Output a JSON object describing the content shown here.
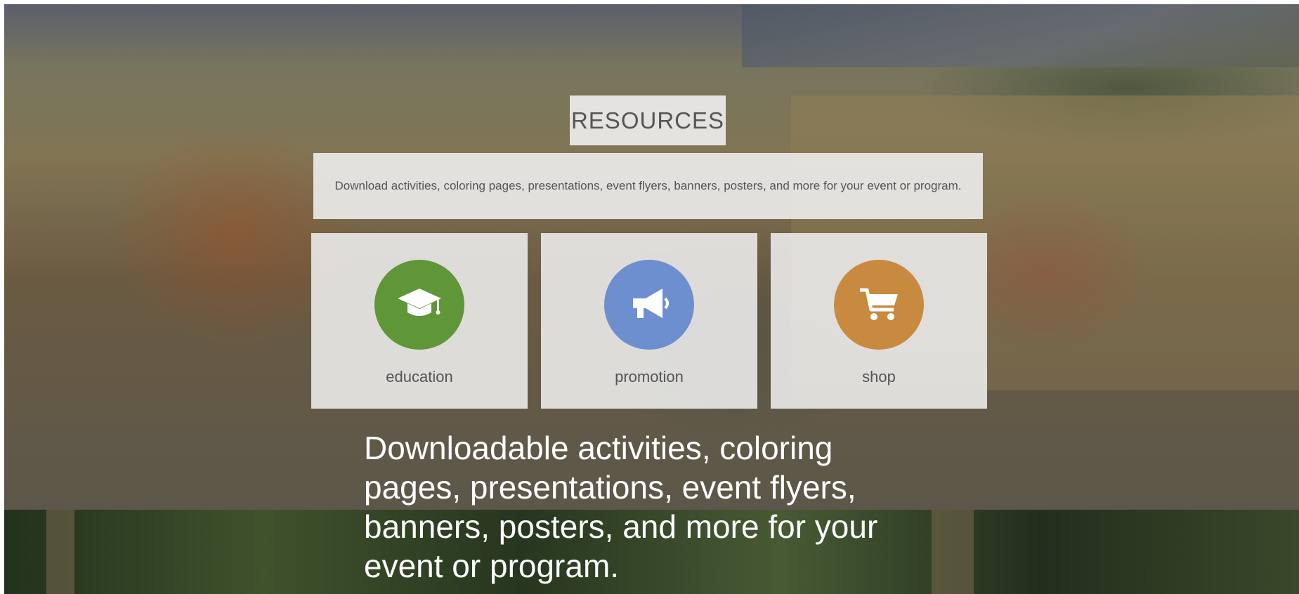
{
  "hero": {
    "title": "RESOURCES",
    "description": "Download activities, coloring pages, presentations, event flyers, banners, posters, and more for your event or program."
  },
  "cards": [
    {
      "label": "education",
      "color": "#5f9638",
      "icon": "graduation-cap-icon"
    },
    {
      "label": "promotion",
      "color": "#6e8fcf",
      "icon": "megaphone-icon"
    },
    {
      "label": "shop",
      "color": "#c88a3f",
      "icon": "shopping-cart-icon"
    }
  ],
  "caption": "Downloadable activities, coloring pages, presentations, event flyers, banners, posters, and more for your event or program."
}
